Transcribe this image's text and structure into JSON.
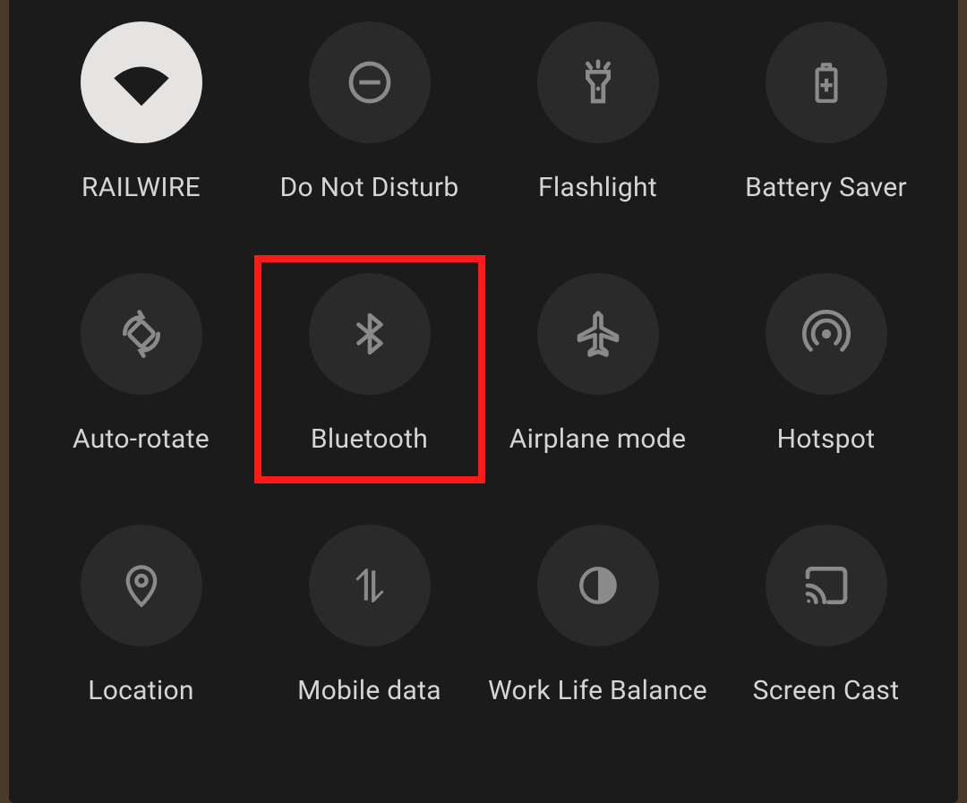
{
  "tiles": [
    {
      "id": "wifi",
      "label": "RAILWIRE",
      "icon": "wifi",
      "active": true,
      "highlighted": false
    },
    {
      "id": "dnd",
      "label": "Do Not Disturb",
      "icon": "dnd",
      "active": false,
      "highlighted": false
    },
    {
      "id": "flashlight",
      "label": "Flashlight",
      "icon": "flashlight",
      "active": false,
      "highlighted": false
    },
    {
      "id": "battery-saver",
      "label": "Battery Saver",
      "icon": "battery-plus",
      "active": false,
      "highlighted": false
    },
    {
      "id": "auto-rotate",
      "label": "Auto-rotate",
      "icon": "rotate",
      "active": false,
      "highlighted": false
    },
    {
      "id": "bluetooth",
      "label": "Bluetooth",
      "icon": "bluetooth",
      "active": false,
      "highlighted": true
    },
    {
      "id": "airplane",
      "label": "Airplane mode",
      "icon": "airplane",
      "active": false,
      "highlighted": false
    },
    {
      "id": "hotspot",
      "label": "Hotspot",
      "icon": "hotspot",
      "active": false,
      "highlighted": false
    },
    {
      "id": "location",
      "label": "Location",
      "icon": "location-pin",
      "active": false,
      "highlighted": false
    },
    {
      "id": "mobile-data",
      "label": "Mobile data",
      "icon": "data-arrows",
      "active": false,
      "highlighted": false
    },
    {
      "id": "wlb",
      "label": "Work Life Balance",
      "icon": "globe-half",
      "active": false,
      "highlighted": false
    },
    {
      "id": "screen-cast",
      "label": "Screen Cast",
      "icon": "cast",
      "active": false,
      "highlighted": false
    }
  ]
}
